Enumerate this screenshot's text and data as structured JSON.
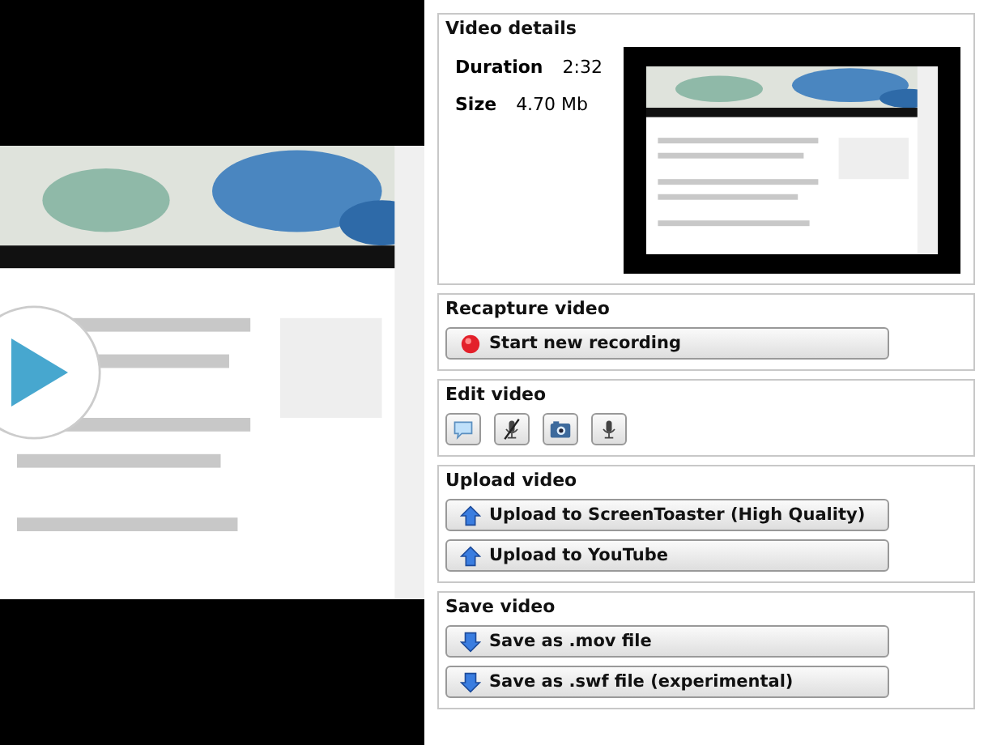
{
  "details": {
    "title": "Video details",
    "facts": [
      {
        "label": "Duration",
        "value": "2:32"
      },
      {
        "label": "Size",
        "value": "4.70 Mb"
      }
    ]
  },
  "sections": [
    {
      "title": "Recapture video",
      "kind": "buttons",
      "buttons": [
        {
          "kind": "record",
          "label": "Start new recording"
        }
      ]
    },
    {
      "title": "Edit video",
      "kind": "tools",
      "tools": [
        {
          "kind": "comment"
        },
        {
          "kind": "mute"
        },
        {
          "kind": "camera"
        },
        {
          "kind": "microphone"
        }
      ]
    },
    {
      "title": "Upload video",
      "kind": "buttons",
      "buttons": [
        {
          "kind": "upload",
          "label": "Upload to ScreenToaster (High Quality)"
        },
        {
          "kind": "upload",
          "label": "Upload to YouTube"
        }
      ]
    },
    {
      "title": "Save video",
      "kind": "buttons",
      "buttons": [
        {
          "kind": "save",
          "label": "Save as .mov file"
        },
        {
          "kind": "save",
          "label": "Save as .swf file (experimental)"
        }
      ]
    }
  ]
}
